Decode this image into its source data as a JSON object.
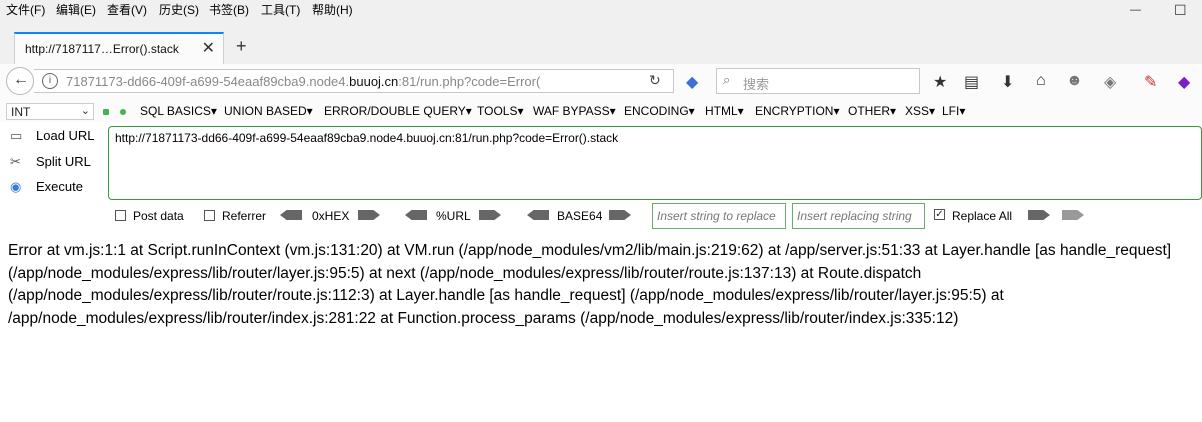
{
  "menu": [
    "文件(F)",
    "编辑(E)",
    "查看(V)",
    "历史(S)",
    "书签(B)",
    "工具(T)",
    "帮助(H)"
  ],
  "window": {
    "minimize": "—",
    "maximize": "☐"
  },
  "tab": {
    "title": "http://7187117…Error().stack",
    "close": "✕",
    "new_tab": "+"
  },
  "navbar": {
    "back": "←",
    "url_prefix": "71871173-dd66-409f-a699-54eaaf89cba9.node4.",
    "url_domain": "buuoj.cn",
    "url_suffix": ":81/run.php?code=Error(",
    "reload": "↻",
    "search_placeholder": "搜索",
    "search_icon": "⌕"
  },
  "nav_icons": [
    "★",
    "▤",
    "⬇",
    "⌂",
    "☻",
    "◈",
    "✎",
    "◆"
  ],
  "hackbar": {
    "select_value": "INT",
    "menus": [
      "SQL BASICS▾",
      "UNION BASED▾",
      "ERROR/DOUBLE QUERY▾",
      "TOOLS▾",
      "WAF BYPASS▾",
      "ENCODING▾",
      "HTML▾",
      "ENCRYPTION▾",
      "OTHER▾",
      "XSS▾",
      "LFI▾"
    ],
    "load_url": "Load URL",
    "split_url": "Split URL",
    "execute": "Execute",
    "textarea_value": "http://71871173-dd66-409f-a699-54eaaf89cba9.node4.buuoj.cn:81/run.php?code=Error().stack",
    "post_data": "Post data",
    "referrer": "Referrer",
    "hex": "0xHEX",
    "url_enc": "%URL",
    "base64": "BASE64",
    "insert_string": "Insert string to replace",
    "insert_replacing": "Insert replacing string",
    "replace_all": "Replace All"
  },
  "page": {
    "error_text": "Error at vm.js:1:1 at Script.runInContext (vm.js:131:20) at VM.run (/app/node_modules/vm2/lib/main.js:219:62) at /app/server.js:51:33 at Layer.handle [as handle_request] (/app/node_modules/express/lib/router/layer.js:95:5) at next (/app/node_modules/express/lib/router/route.js:137:13) at Route.dispatch (/app/node_modules/express/lib/router/route.js:112:3) at Layer.handle [as handle_request] (/app/node_modules/express/lib/router/layer.js:95:5) at /app/node_modules/express/lib/router/index.js:281:22 at Function.process_params (/app/node_modules/express/lib/router/index.js:335:12)"
  }
}
